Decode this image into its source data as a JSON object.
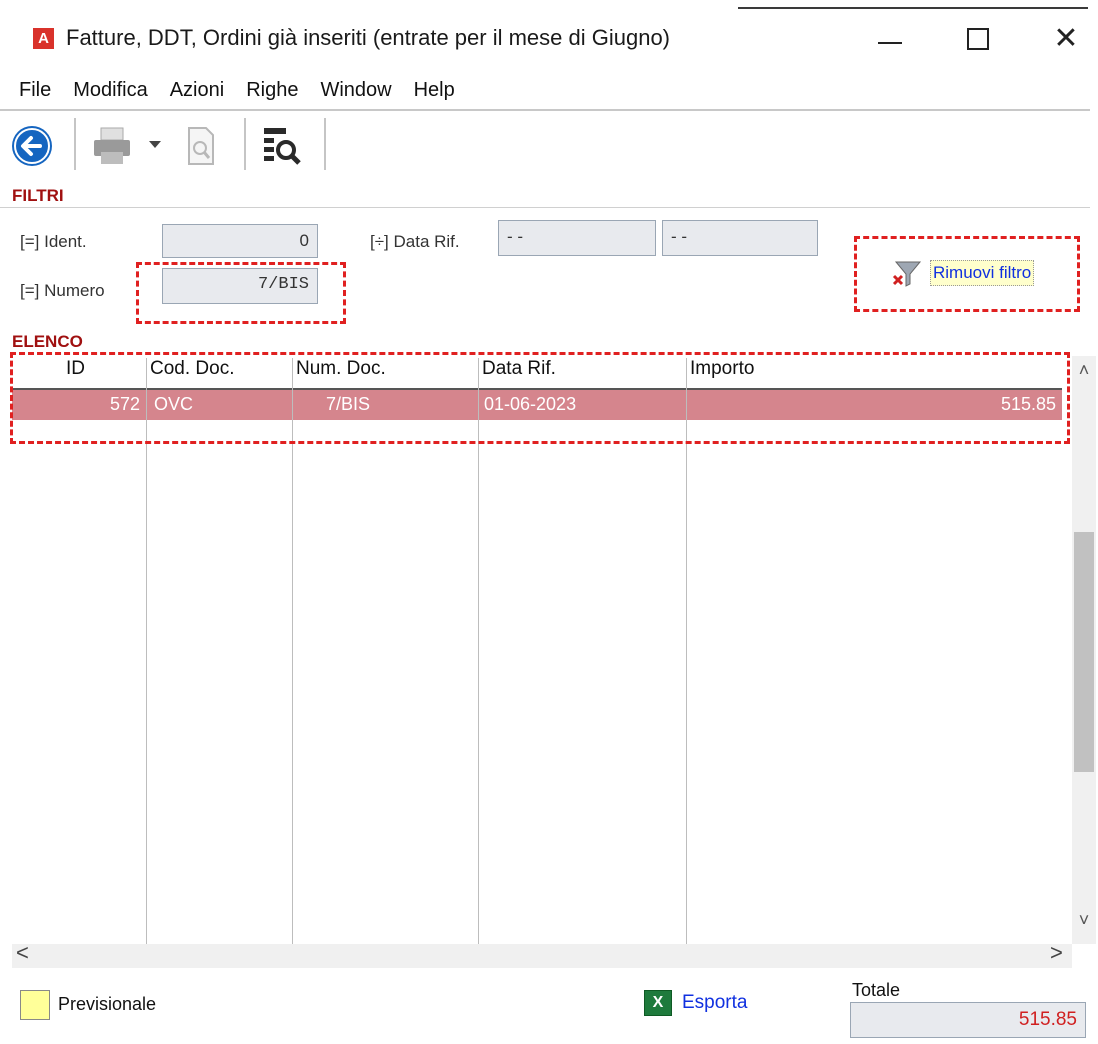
{
  "window": {
    "title": "Fatture, DDT, Ordini già inseriti (entrate per il mese di Giugno)",
    "app_icon_letter": "A",
    "minimize_glyph": "—",
    "maximize_glyph": "□",
    "close_glyph": "✕"
  },
  "menu": [
    "File",
    "Modifica",
    "Azioni",
    "Righe",
    "Window",
    "Help"
  ],
  "toolbar": {
    "buttons": [
      "back-arrow-icon",
      "printer-icon",
      "dropdown-arrow-icon",
      "print-preview-icon",
      "search-list-icon"
    ]
  },
  "filters": {
    "section_label": "FILTRI",
    "ident_label": "[=] Ident.",
    "ident_value": "0",
    "numero_label": "[=] Numero",
    "numero_value": "7/BIS",
    "datarif_label": "[÷] Data Rif.",
    "date_from": "- -",
    "date_to": "- -",
    "remove_filter_label": "Rimuovi filtro"
  },
  "list": {
    "section_label": "ELENCO",
    "columns": [
      "ID",
      "Cod. Doc.",
      "Num. Doc.",
      "Data Rif.",
      "Importo"
    ],
    "rows": [
      {
        "id": "572",
        "cod_doc": "OVC",
        "num_doc": "7/BIS",
        "data_rif": "01-06-2023",
        "importo": "515.85"
      }
    ],
    "selected_row_color": "#d5858d"
  },
  "scroll": {
    "up": "˄",
    "down": "˅",
    "left": "<",
    "right": ">"
  },
  "footer": {
    "legend_label": "Previsionale",
    "legend_color": "#ffff99",
    "export_label": "Esporta",
    "export_icon_letter": "X",
    "totale_label": "Totale",
    "totale_value": "515.85"
  },
  "colors": {
    "section": "#a01010",
    "link": "#1030e0",
    "highlight_dash": "#e02020"
  }
}
